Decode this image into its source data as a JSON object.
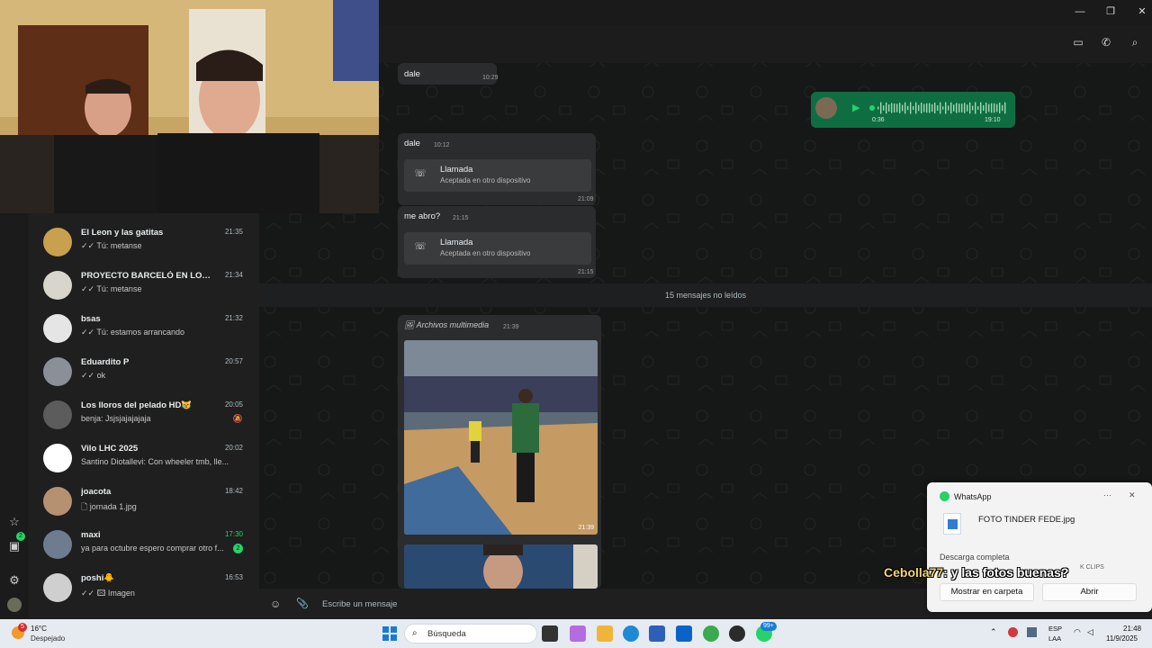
{
  "window": {
    "minimize": "—",
    "maximize": "❐",
    "close": "✕"
  },
  "header": {
    "video_icon": "video-icon",
    "call_icon": "phone-icon",
    "search_icon": "search-icon"
  },
  "chats": [
    {
      "name": "El Leon y las gatitas",
      "time": "21:35",
      "preview": "✓✓ Tú: metanse",
      "avatar_color": "#c9a04d"
    },
    {
      "name": "PROYECTO BARCELÓ EN LOS GL...",
      "time": "21:34",
      "preview": "✓✓ Tú: metanse",
      "avatar_color": "#d8d5cc"
    },
    {
      "name": "bsas",
      "time": "21:32",
      "preview": "✓✓ Tú: estamos arrancando",
      "avatar_color": "#e5e5e5"
    },
    {
      "name": "Eduardito P",
      "time": "20:57",
      "preview": "✓✓ ok",
      "avatar_color": "#8a8f98"
    },
    {
      "name": "Los lloros del pelado HD😿",
      "time": "20:05",
      "preview": "benja: Jsjsjajajajaja",
      "avatar_color": "#5c5c5c",
      "muted": "🔕"
    },
    {
      "name": "Vilo LHC 2025",
      "time": "20:02",
      "preview": "Santino Diotallevi: Con wheeler tmb, lle...",
      "avatar_color": "#ffffff"
    },
    {
      "name": "joacota",
      "time": "18:42",
      "preview": "🗋 jornada 1.jpg",
      "avatar_color": "#b59071"
    },
    {
      "name": "maxi",
      "time": "17:30",
      "preview": "ya para octubre espero comprar otro f...",
      "avatar_color": "#6d7d8f",
      "unread": "2"
    },
    {
      "name": "poshi🐥",
      "time": "16:53",
      "preview": "✓✓ 🖾 Imagen",
      "avatar_color": "#cfcfcf"
    }
  ],
  "rail": {
    "star_icon": "star-icon",
    "status_badge": "2",
    "settings_icon": "gear-icon"
  },
  "messages": {
    "m1_text": "dale",
    "m1_time": "10:29",
    "m2_text": "dale",
    "m2_time": "10:12",
    "call1_title": "Llamada",
    "call1_sub": "Aceptada en otro dispositivo",
    "call1_time": "21:09",
    "m3_text": "me abro?",
    "m3_time": "21:15",
    "call2_title": "Llamada",
    "call2_sub": "Aceptada en otro dispositivo",
    "call2_time": "21:15",
    "unread_divider": "15 mensajes no leídos",
    "media_label": "🖼 Archivos multimedia",
    "media_time": "21:39",
    "photo_time": "21:39"
  },
  "voice": {
    "duration": "0:36",
    "time": "19:10",
    "play": "▶"
  },
  "composer": {
    "placeholder": "Escribe un mensaje",
    "emoji": "☺",
    "attach": "📎"
  },
  "toast": {
    "app": "WhatsApp",
    "file": "FOTO TINDER FEDE.jpg",
    "status": "Descarga completa",
    "btn_folder": "Mostrar en carpeta",
    "btn_open": "Abrir",
    "more": "···",
    "close": "✕",
    "partial": "K CLIPS"
  },
  "caption": {
    "user": "Cebolla77",
    "text": ": y las fotos buenas?"
  },
  "taskbar": {
    "weather_temp": "16°C",
    "weather_desc": "Despejado",
    "weather_badge": "5",
    "search": "Búsqueda",
    "lang1": "ESP",
    "lang2": "LAA",
    "clock_time": "21:48",
    "clock_date": "11/9/2025",
    "app_badge": "99+"
  },
  "colors": {
    "accent": "#25d366",
    "voice_bubble": "#0f6e41",
    "chat_bg": "#161717"
  }
}
